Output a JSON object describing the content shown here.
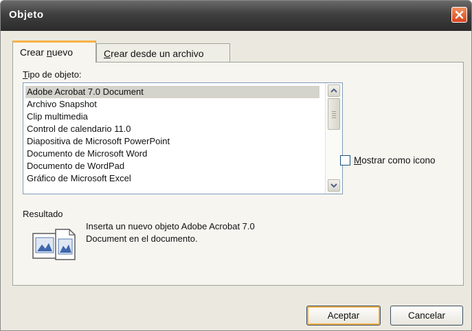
{
  "window": {
    "title": "Objeto",
    "close_icon": "close-icon"
  },
  "tabs": [
    {
      "label_pre": "Crear ",
      "label_accel": "n",
      "label_post": "uevo",
      "active": true
    },
    {
      "label_pre": "",
      "label_accel": "C",
      "label_post": "rear desde un archivo",
      "active": false
    }
  ],
  "object_type": {
    "label_accel": "T",
    "label_rest": "ipo de objeto:",
    "items": [
      "Adobe Acrobat 7.0 Document",
      "Archivo Snapshot",
      "Clip multimedia",
      "Control de calendario 11.0",
      "Diapositiva de Microsoft PowerPoint",
      "Documento de Microsoft Word",
      "Documento de WordPad",
      "Gráfico de Microsoft Excel"
    ],
    "selected_index": 0
  },
  "show_as_icon": {
    "label_accel": "M",
    "label_rest": "ostrar como icono",
    "checked": false
  },
  "result": {
    "label": "Resultado",
    "line1": "Inserta un nuevo objeto Adobe Acrobat 7.0",
    "line2": "Document en el documento."
  },
  "buttons": {
    "ok": "Aceptar",
    "cancel": "Cancelar"
  },
  "colors": {
    "title_bar": "#3f3f3f",
    "close_button": "#d9431b",
    "tab_accent": "#f6b144",
    "dialog_bg": "#ebe9df"
  }
}
